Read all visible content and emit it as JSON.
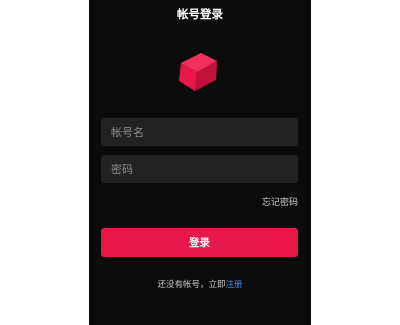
{
  "header": {
    "title": "帐号登录"
  },
  "logo": {
    "icon": "cube-icon",
    "color": "#e8174a"
  },
  "form": {
    "username_placeholder": "帐号名",
    "password_placeholder": "密码",
    "forgot_label": "忘记密码",
    "submit_label": "登录"
  },
  "footer": {
    "prompt": "还没有帐号，立即",
    "register_label": "注册"
  },
  "colors": {
    "background": "#0b0b0b",
    "field": "#222222",
    "accent": "#e8174a",
    "link": "#3e8ef0"
  }
}
